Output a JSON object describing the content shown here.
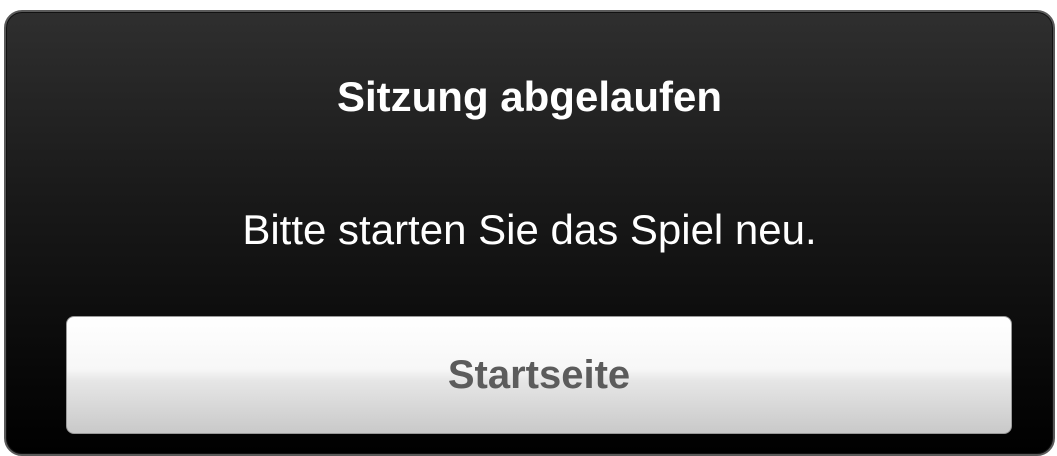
{
  "dialog": {
    "title": "Sitzung abgelaufen",
    "message": "Bitte starten Sie das Spiel neu.",
    "button_label": "Startseite"
  }
}
